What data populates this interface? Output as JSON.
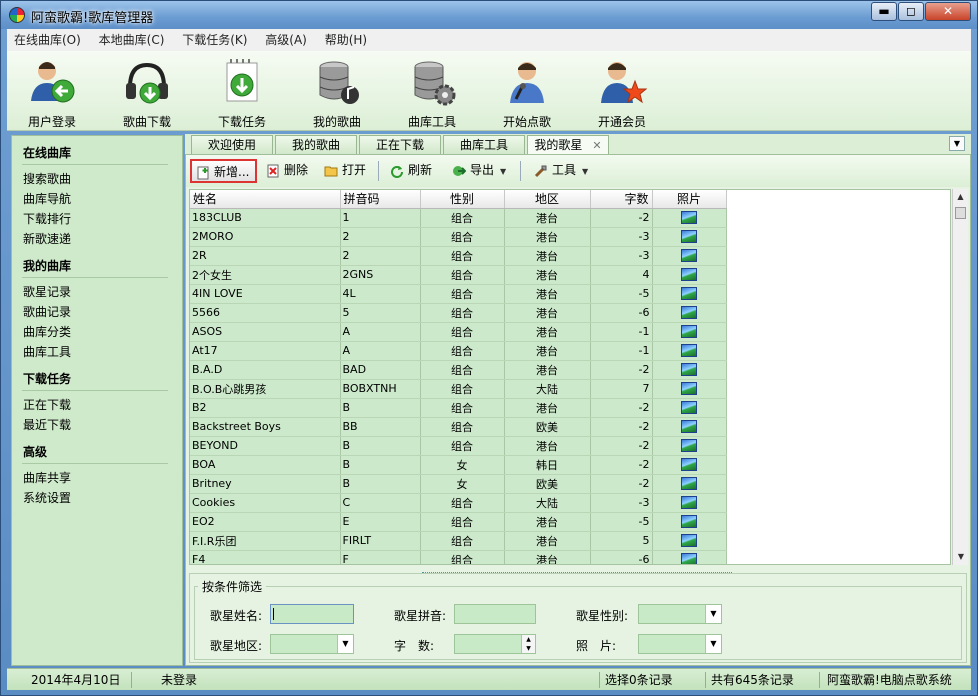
{
  "window": {
    "title": "阿蛮歌霸!歌库管理器",
    "min": "▬",
    "max": "◻",
    "close": "✕"
  },
  "menu": [
    "在线曲库(O)",
    "本地曲库(C)",
    "下载任务(K)",
    "高级(A)",
    "帮助(H)"
  ],
  "big_toolbar": [
    {
      "label": "用户登录",
      "icon": "user-login-icon"
    },
    {
      "label": "歌曲下载",
      "icon": "headphone-download-icon"
    },
    {
      "label": "下载任务",
      "icon": "download-task-icon"
    },
    {
      "label": "我的歌曲",
      "icon": "database-music-icon"
    },
    {
      "label": "曲库工具",
      "icon": "database-gear-icon"
    },
    {
      "label": "开始点歌",
      "icon": "singer-mic-icon"
    },
    {
      "label": "开通会员",
      "icon": "vip-star-icon"
    }
  ],
  "nav": [
    {
      "title": "在线曲库",
      "items": [
        "搜索歌曲",
        "曲库导航",
        "下载排行",
        "新歌速递"
      ]
    },
    {
      "title": "我的曲库",
      "items": [
        "歌星记录",
        "歌曲记录",
        "曲库分类",
        "曲库工具"
      ]
    },
    {
      "title": "下载任务",
      "items": [
        "正在下载",
        "最近下载"
      ]
    },
    {
      "title": "高级",
      "items": [
        "曲库共享",
        "系统设置"
      ]
    }
  ],
  "tabs": [
    "欢迎使用",
    "我的歌曲",
    "正在下载",
    "曲库工具",
    "我的歌星"
  ],
  "tab_close": "✕",
  "toolbar": {
    "new": "新增...",
    "delete": "删除",
    "open": "打开",
    "refresh": "刷新",
    "export": "导出",
    "tools": "工具"
  },
  "table": {
    "headers": [
      "姓名",
      "拼音码",
      "性别",
      "地区",
      "字数",
      "照片"
    ],
    "rows": [
      [
        "183CLUB",
        "1",
        "组合",
        "港台",
        "-2"
      ],
      [
        "2MORO",
        "2",
        "组合",
        "港台",
        "-3"
      ],
      [
        "2R",
        "2",
        "组合",
        "港台",
        "-3"
      ],
      [
        "2个女生",
        "2GNS",
        "组合",
        "港台",
        "4"
      ],
      [
        "4IN LOVE",
        "4L",
        "组合",
        "港台",
        "-5"
      ],
      [
        "5566",
        "5",
        "组合",
        "港台",
        "-6"
      ],
      [
        "ASOS",
        "A",
        "组合",
        "港台",
        "-1"
      ],
      [
        "At17",
        "A",
        "组合",
        "港台",
        "-1"
      ],
      [
        "B.A.D",
        "BAD",
        "组合",
        "港台",
        "-2"
      ],
      [
        "B.O.B心跳男孩",
        "BOBXTNH",
        "组合",
        "大陆",
        "7"
      ],
      [
        "B2",
        "B",
        "组合",
        "港台",
        "-2"
      ],
      [
        "Backstreet Boys",
        "BB",
        "组合",
        "欧美",
        "-2"
      ],
      [
        "BEYOND",
        "B",
        "组合",
        "港台",
        "-2"
      ],
      [
        "BOA",
        "B",
        "女",
        "韩日",
        "-2"
      ],
      [
        "Britney",
        "B",
        "女",
        "欧美",
        "-2"
      ],
      [
        "Cookies",
        "C",
        "组合",
        "大陆",
        "-3"
      ],
      [
        "EO2",
        "E",
        "组合",
        "港台",
        "-5"
      ],
      [
        "F.I.R乐团",
        "FIRLT",
        "组合",
        "港台",
        "5"
      ],
      [
        "F4",
        "F",
        "组合",
        "港台",
        "-6"
      ]
    ]
  },
  "filter": {
    "title": "按条件筛选",
    "name_label": "歌星姓名:",
    "pinyin_label": "歌星拼音:",
    "gender_label": "歌星性别:",
    "region_label": "歌星地区:",
    "count_label": "字　数:",
    "photo_label": "照　片:"
  },
  "status": {
    "date": "2014年4月10日",
    "login": "未登录",
    "selected": "选择0条记录",
    "total": "共有645条记录",
    "brand": "阿蛮歌霸!电脑点歌系统"
  }
}
